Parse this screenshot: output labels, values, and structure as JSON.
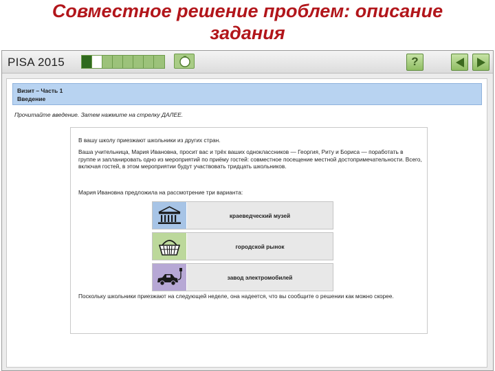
{
  "slide": {
    "title_line1": "Совместное решение проблем: описание",
    "title_line2": "задания"
  },
  "app": {
    "logo": "PISA 2015",
    "progress_total_segments": 8,
    "progress_done_segments": 1,
    "progress_current_segment": 2
  },
  "task": {
    "part": "Визит – Часть 1",
    "section": "Введение",
    "instruction": "Прочитайте введение. Затем нажмите на стрелку ДАЛЕЕ."
  },
  "content": {
    "p1": "В вашу школу приезжают школьники из других стран.",
    "p2": "Ваша учительница, Мария Ивановна, просит вас и трёх ваших одноклассников — Георгия, Риту и Бориса — поработать в группе и запланировать одно из мероприятий по приёму гостей: совместное посещение местной достопримечательности. Всего, включая гостей, в этом мероприятии будут участвовать тридцать школьников.",
    "p3": "Мария Ивановна предложила на рассмотрение три варианта:",
    "p4": "Поскольку школьники приезжают на следующей неделе, она надеется, что вы сообщите о решении как можно скорее."
  },
  "options": [
    {
      "label": "краеведческий музей",
      "icon": "museum-icon"
    },
    {
      "label": "городской рынок",
      "icon": "market-basket-icon"
    },
    {
      "label": "завод электромобилей",
      "icon": "electric-car-icon"
    }
  ],
  "colors": {
    "title": "#b2161b",
    "header_bg": "#b8d3f1",
    "museum_bg": "#a7c4e6",
    "market_bg": "#bcd89b",
    "factory_bg": "#b7a8d5",
    "nav_green": "#8fbd63"
  }
}
